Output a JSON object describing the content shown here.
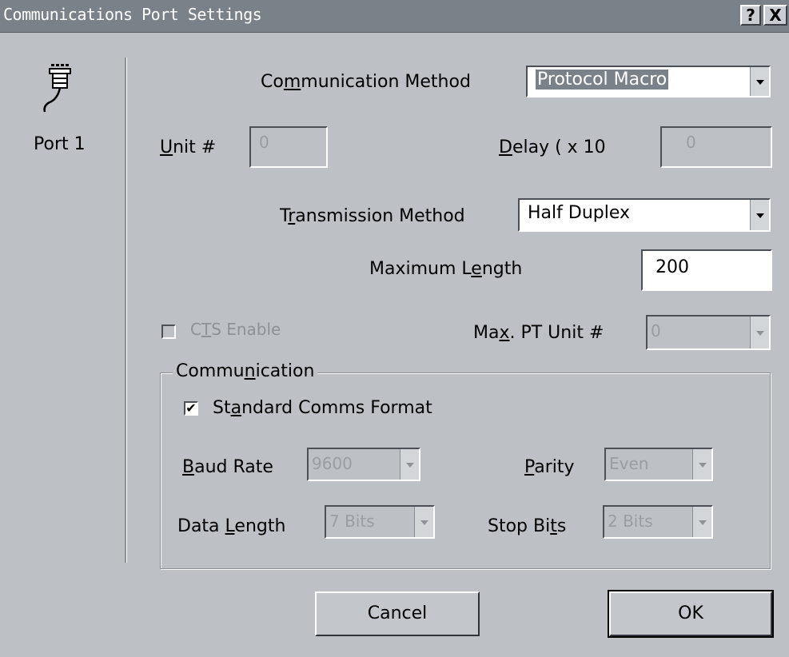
{
  "window": {
    "title": "Communications Port Settings",
    "help_label": "?",
    "close_label": "X"
  },
  "port": {
    "label": "Port 1",
    "icon": "serial-port-icon"
  },
  "comm_method": {
    "label_pre": "Co",
    "label_ul": "m",
    "label_post": "munication Method",
    "value": "Protocol Macro"
  },
  "unit": {
    "label_ul": "U",
    "label_post": "nit #",
    "value": "0"
  },
  "delay": {
    "label_ul": "D",
    "label_post": "elay ( x 10",
    "value": "0"
  },
  "transmission": {
    "label_pre": "T",
    "label_ul": "r",
    "label_post": "ansmission Method",
    "value": "Half Duplex"
  },
  "max_length": {
    "label_pre": "Maximum L",
    "label_ul": "e",
    "label_post": "ngth",
    "value": "200"
  },
  "cts": {
    "label_pre": "C",
    "label_ul": "T",
    "label_post": "S Enable",
    "checked": false
  },
  "max_pt_unit": {
    "label_pre": "Ma",
    "label_ul": "x",
    "label_post": ". PT Unit #",
    "value": "0"
  },
  "communication_group": {
    "title_pre": "Commu",
    "title_ul": "n",
    "title_post": "ication",
    "standard_pre": "St",
    "standard_ul": "a",
    "standard_post": "ndard Comms Format",
    "standard_checked": true,
    "baud": {
      "label_ul": "B",
      "label_post": "aud Rate",
      "value": "9600"
    },
    "parity": {
      "label_ul": "P",
      "label_post": "arity",
      "value": "Even"
    },
    "data_length": {
      "label_pre": "Data ",
      "label_ul": "L",
      "label_post": "ength",
      "value": "7 Bits"
    },
    "stop_bits": {
      "label_pre": "Stop Bi",
      "label_ul": "t",
      "label_post": "s",
      "value": "2 Bits"
    }
  },
  "buttons": {
    "cancel": "Cancel",
    "ok": "OK"
  },
  "check_glyph": "✔"
}
